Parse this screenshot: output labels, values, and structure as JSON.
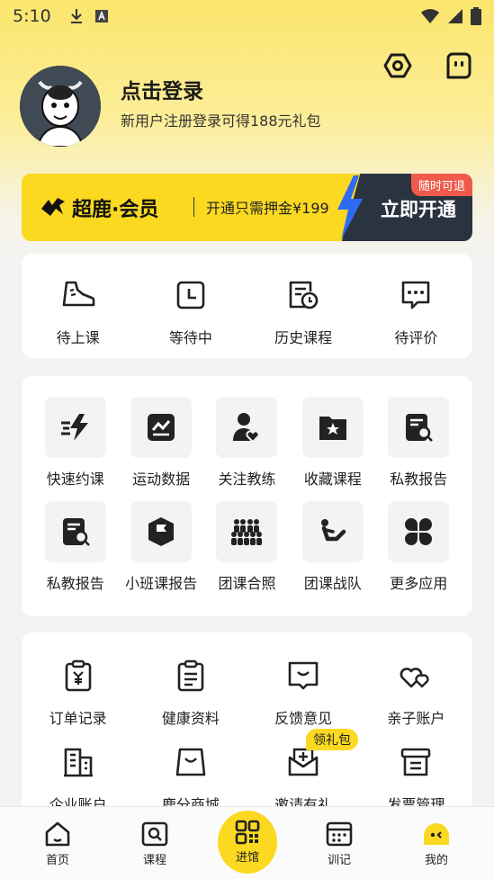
{
  "status_bar": {
    "time": "5:10"
  },
  "profile": {
    "login_title": "点击登录",
    "login_subtitle": "新用户注册登录可得188元礼包"
  },
  "vip": {
    "brand": "超鹿·会员",
    "deposit_text": "开通只需押金¥199",
    "cta": "立即开通",
    "tag": "随时可退"
  },
  "course_status": [
    {
      "label": "待上课",
      "icon": "sneaker-icon"
    },
    {
      "label": "等待中",
      "icon": "clock-icon"
    },
    {
      "label": "历史课程",
      "icon": "history-icon"
    },
    {
      "label": "待评价",
      "icon": "comment-icon"
    }
  ],
  "services": [
    {
      "label": "快速约课",
      "icon": "lightning-icon"
    },
    {
      "label": "运动数据",
      "icon": "chart-icon"
    },
    {
      "label": "关注教练",
      "icon": "coach-heart-icon"
    },
    {
      "label": "收藏课程",
      "icon": "folder-star-icon"
    },
    {
      "label": "私教报告",
      "icon": "report-search-icon"
    },
    {
      "label": "私教报告",
      "icon": "report-search-icon"
    },
    {
      "label": "小班课报告",
      "icon": "flag-hexagon-icon"
    },
    {
      "label": "团课合照",
      "icon": "group-icon"
    },
    {
      "label": "团课战队",
      "icon": "situp-icon"
    },
    {
      "label": "更多应用",
      "icon": "apps-icon"
    }
  ],
  "tools": [
    {
      "label": "订单记录",
      "icon": "clipboard-yen-icon"
    },
    {
      "label": "健康资料",
      "icon": "clipboard-list-icon"
    },
    {
      "label": "反馈意见",
      "icon": "feedback-icon"
    },
    {
      "label": "亲子账户",
      "icon": "hearts-icon"
    },
    {
      "label": "企业账户",
      "icon": "building-icon"
    },
    {
      "label": "鹿分商城",
      "icon": "shopping-bag-icon"
    },
    {
      "label": "邀请有礼",
      "icon": "invite-mail-icon"
    },
    {
      "label": "发票管理",
      "icon": "invoice-box-icon"
    }
  ],
  "gift_badge": "领礼包",
  "tabbar": [
    {
      "label": "首页",
      "icon": "home-icon"
    },
    {
      "label": "课程",
      "icon": "course-search-icon"
    },
    {
      "label": "进馆",
      "icon": "qr-code-icon"
    },
    {
      "label": "训记",
      "icon": "calendar-icon"
    },
    {
      "label": "我的",
      "icon": "me-face-icon"
    }
  ],
  "colors": {
    "brand_yellow": "#fbd921",
    "dark_navy": "#2a3340",
    "tag_red": "#f05a4b"
  }
}
